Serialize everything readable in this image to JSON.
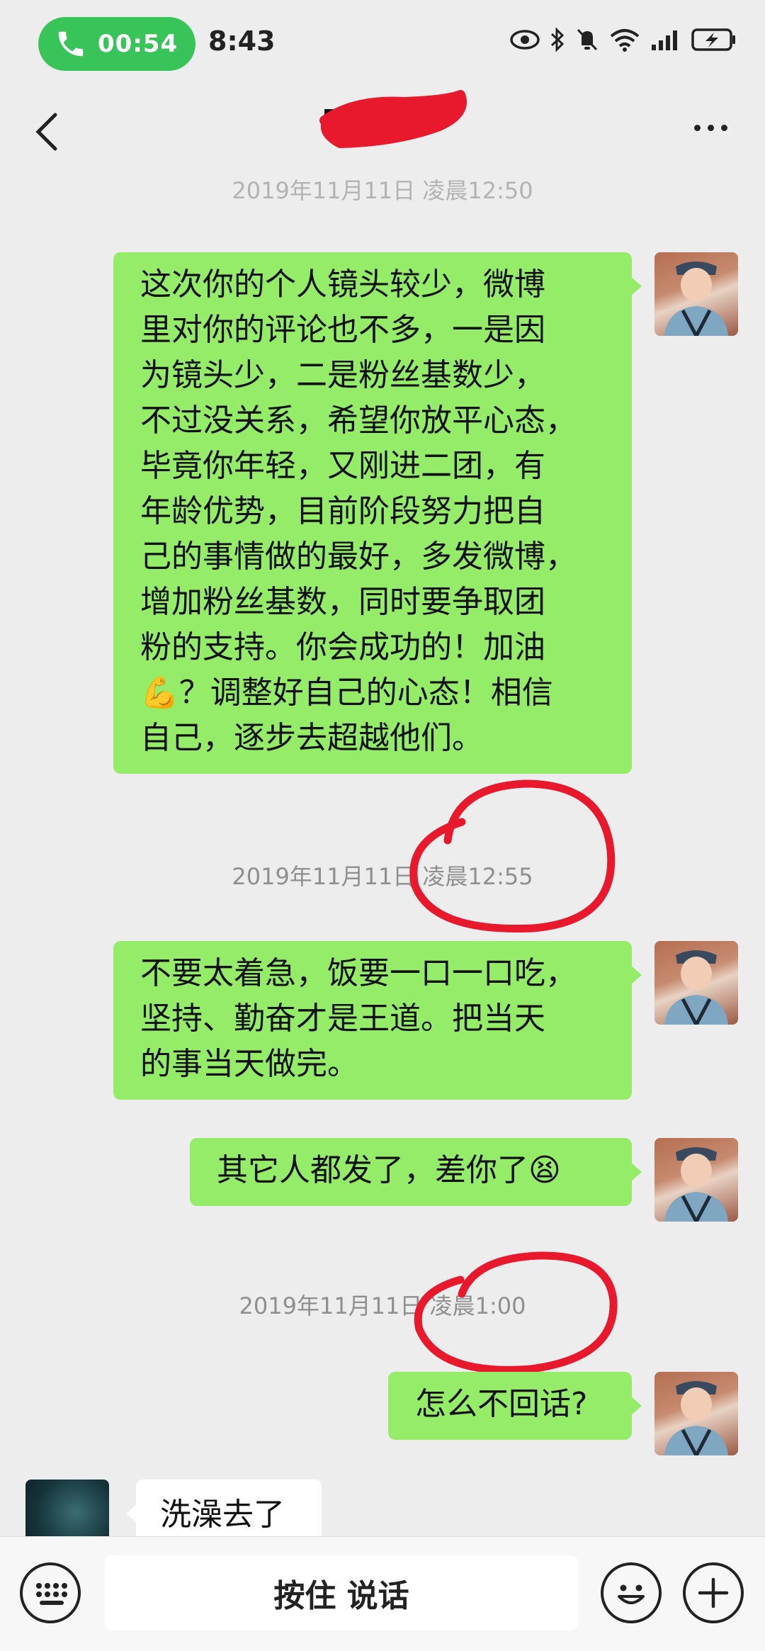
{
  "status_bar": {
    "call_duration": "00:54",
    "time": "8:43",
    "icons": [
      "phone-icon",
      "eye-icon",
      "bluetooth-icon",
      "mute-icon",
      "wifi-icon",
      "signal-icon",
      "battery-charging-icon"
    ]
  },
  "header": {
    "title": "",
    "back_icon": "chevron-left-icon",
    "more_icon": "more-dots-icon"
  },
  "messages": [
    {
      "type": "timestamp",
      "text": "2019年11月11日 凌晨12:50"
    },
    {
      "type": "sent",
      "lines": [
        "这次你的个人镜头较少，微博",
        "里对你的评论也不多，一是因",
        "为镜头少，二是粉丝基数少，",
        "不过没关系，希望你放平心态，",
        "毕竟你年轻，又刚进二团，有",
        "年龄优势，目前阶段努力把自",
        "己的事情做的最好，多发微博，",
        "增加粉丝基数，同时要争取团",
        "粉的支持。你会成功的！加油",
        "💪？调整好自己的心态！相信",
        "自己，逐步去超越他们。"
      ]
    },
    {
      "type": "timestamp",
      "text": "2019年11月11日 凌晨12:55"
    },
    {
      "type": "sent",
      "lines": [
        "不要太着急，饭要一口一口吃，",
        "坚持、勤奋才是王道。把当天",
        "的事当天做完。"
      ]
    },
    {
      "type": "sent",
      "lines": [
        "其它人都发了，差你了😫"
      ]
    },
    {
      "type": "timestamp",
      "text": "2019年11月11日 凌晨1:00"
    },
    {
      "type": "sent",
      "lines": [
        "怎么不回话?"
      ]
    },
    {
      "type": "received",
      "lines": [
        "洗澡去了"
      ]
    }
  ],
  "input_bar": {
    "voice_label": "按住 说话",
    "keyboard_icon": "keyboard-icon",
    "emoji_icon": "emoji-icon",
    "plus_icon": "plus-icon"
  },
  "colors": {
    "sent_bubble": "#95ec69",
    "received_bubble": "#ffffff",
    "background": "#ededed",
    "call_pill": "#39c45a",
    "annotation_red": "#e8192c"
  }
}
